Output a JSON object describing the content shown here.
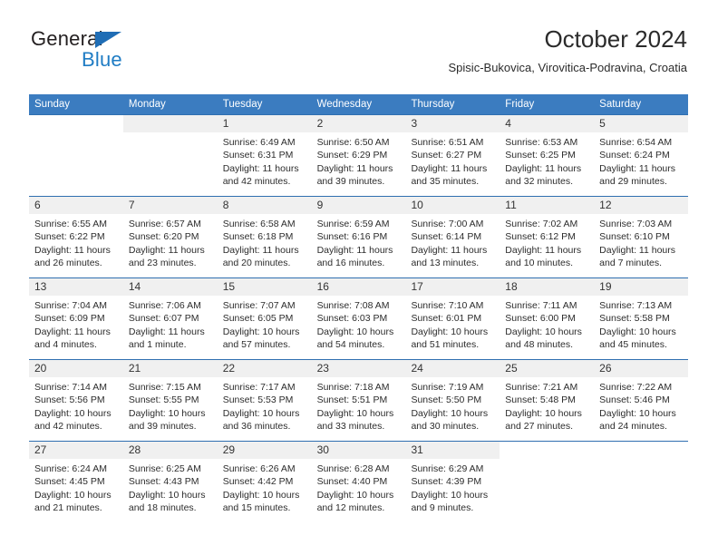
{
  "brand": {
    "name_top": "General",
    "name_bottom": "Blue",
    "triangle_color": "#1f6db5",
    "blue_color": "#1f7cc4"
  },
  "header": {
    "title": "October 2024",
    "subtitle": "Spisic-Bukovica, Virovitica-Podravina, Croatia"
  },
  "theme": {
    "header_bg": "#3b7cc0",
    "row_border": "#2f6fb0",
    "daynum_bg": "#f0f0f0",
    "text": "#2c2c2c"
  },
  "calendar": {
    "weekday_headers": [
      "Sunday",
      "Monday",
      "Tuesday",
      "Wednesday",
      "Thursday",
      "Friday",
      "Saturday"
    ],
    "weeks": [
      [
        {
          "day": "",
          "blank": true,
          "sunrise": "",
          "sunset": "",
          "daylight1": "",
          "daylight2": ""
        },
        {
          "day": "",
          "blank": false,
          "sunrise": "",
          "sunset": "",
          "daylight1": "",
          "daylight2": ""
        },
        {
          "day": "1",
          "sunrise": "Sunrise: 6:49 AM",
          "sunset": "Sunset: 6:31 PM",
          "daylight1": "Daylight: 11 hours",
          "daylight2": "and 42 minutes."
        },
        {
          "day": "2",
          "sunrise": "Sunrise: 6:50 AM",
          "sunset": "Sunset: 6:29 PM",
          "daylight1": "Daylight: 11 hours",
          "daylight2": "and 39 minutes."
        },
        {
          "day": "3",
          "sunrise": "Sunrise: 6:51 AM",
          "sunset": "Sunset: 6:27 PM",
          "daylight1": "Daylight: 11 hours",
          "daylight2": "and 35 minutes."
        },
        {
          "day": "4",
          "sunrise": "Sunrise: 6:53 AM",
          "sunset": "Sunset: 6:25 PM",
          "daylight1": "Daylight: 11 hours",
          "daylight2": "and 32 minutes."
        },
        {
          "day": "5",
          "sunrise": "Sunrise: 6:54 AM",
          "sunset": "Sunset: 6:24 PM",
          "daylight1": "Daylight: 11 hours",
          "daylight2": "and 29 minutes."
        }
      ],
      [
        {
          "day": "6",
          "sunrise": "Sunrise: 6:55 AM",
          "sunset": "Sunset: 6:22 PM",
          "daylight1": "Daylight: 11 hours",
          "daylight2": "and 26 minutes."
        },
        {
          "day": "7",
          "sunrise": "Sunrise: 6:57 AM",
          "sunset": "Sunset: 6:20 PM",
          "daylight1": "Daylight: 11 hours",
          "daylight2": "and 23 minutes."
        },
        {
          "day": "8",
          "sunrise": "Sunrise: 6:58 AM",
          "sunset": "Sunset: 6:18 PM",
          "daylight1": "Daylight: 11 hours",
          "daylight2": "and 20 minutes."
        },
        {
          "day": "9",
          "sunrise": "Sunrise: 6:59 AM",
          "sunset": "Sunset: 6:16 PM",
          "daylight1": "Daylight: 11 hours",
          "daylight2": "and 16 minutes."
        },
        {
          "day": "10",
          "sunrise": "Sunrise: 7:00 AM",
          "sunset": "Sunset: 6:14 PM",
          "daylight1": "Daylight: 11 hours",
          "daylight2": "and 13 minutes."
        },
        {
          "day": "11",
          "sunrise": "Sunrise: 7:02 AM",
          "sunset": "Sunset: 6:12 PM",
          "daylight1": "Daylight: 11 hours",
          "daylight2": "and 10 minutes."
        },
        {
          "day": "12",
          "sunrise": "Sunrise: 7:03 AM",
          "sunset": "Sunset: 6:10 PM",
          "daylight1": "Daylight: 11 hours",
          "daylight2": "and 7 minutes."
        }
      ],
      [
        {
          "day": "13",
          "sunrise": "Sunrise: 7:04 AM",
          "sunset": "Sunset: 6:09 PM",
          "daylight1": "Daylight: 11 hours",
          "daylight2": "and 4 minutes."
        },
        {
          "day": "14",
          "sunrise": "Sunrise: 7:06 AM",
          "sunset": "Sunset: 6:07 PM",
          "daylight1": "Daylight: 11 hours",
          "daylight2": "and 1 minute."
        },
        {
          "day": "15",
          "sunrise": "Sunrise: 7:07 AM",
          "sunset": "Sunset: 6:05 PM",
          "daylight1": "Daylight: 10 hours",
          "daylight2": "and 57 minutes."
        },
        {
          "day": "16",
          "sunrise": "Sunrise: 7:08 AM",
          "sunset": "Sunset: 6:03 PM",
          "daylight1": "Daylight: 10 hours",
          "daylight2": "and 54 minutes."
        },
        {
          "day": "17",
          "sunrise": "Sunrise: 7:10 AM",
          "sunset": "Sunset: 6:01 PM",
          "daylight1": "Daylight: 10 hours",
          "daylight2": "and 51 minutes."
        },
        {
          "day": "18",
          "sunrise": "Sunrise: 7:11 AM",
          "sunset": "Sunset: 6:00 PM",
          "daylight1": "Daylight: 10 hours",
          "daylight2": "and 48 minutes."
        },
        {
          "day": "19",
          "sunrise": "Sunrise: 7:13 AM",
          "sunset": "Sunset: 5:58 PM",
          "daylight1": "Daylight: 10 hours",
          "daylight2": "and 45 minutes."
        }
      ],
      [
        {
          "day": "20",
          "sunrise": "Sunrise: 7:14 AM",
          "sunset": "Sunset: 5:56 PM",
          "daylight1": "Daylight: 10 hours",
          "daylight2": "and 42 minutes."
        },
        {
          "day": "21",
          "sunrise": "Sunrise: 7:15 AM",
          "sunset": "Sunset: 5:55 PM",
          "daylight1": "Daylight: 10 hours",
          "daylight2": "and 39 minutes."
        },
        {
          "day": "22",
          "sunrise": "Sunrise: 7:17 AM",
          "sunset": "Sunset: 5:53 PM",
          "daylight1": "Daylight: 10 hours",
          "daylight2": "and 36 minutes."
        },
        {
          "day": "23",
          "sunrise": "Sunrise: 7:18 AM",
          "sunset": "Sunset: 5:51 PM",
          "daylight1": "Daylight: 10 hours",
          "daylight2": "and 33 minutes."
        },
        {
          "day": "24",
          "sunrise": "Sunrise: 7:19 AM",
          "sunset": "Sunset: 5:50 PM",
          "daylight1": "Daylight: 10 hours",
          "daylight2": "and 30 minutes."
        },
        {
          "day": "25",
          "sunrise": "Sunrise: 7:21 AM",
          "sunset": "Sunset: 5:48 PM",
          "daylight1": "Daylight: 10 hours",
          "daylight2": "and 27 minutes."
        },
        {
          "day": "26",
          "sunrise": "Sunrise: 7:22 AM",
          "sunset": "Sunset: 5:46 PM",
          "daylight1": "Daylight: 10 hours",
          "daylight2": "and 24 minutes."
        }
      ],
      [
        {
          "day": "27",
          "sunrise": "Sunrise: 6:24 AM",
          "sunset": "Sunset: 4:45 PM",
          "daylight1": "Daylight: 10 hours",
          "daylight2": "and 21 minutes."
        },
        {
          "day": "28",
          "sunrise": "Sunrise: 6:25 AM",
          "sunset": "Sunset: 4:43 PM",
          "daylight1": "Daylight: 10 hours",
          "daylight2": "and 18 minutes."
        },
        {
          "day": "29",
          "sunrise": "Sunrise: 6:26 AM",
          "sunset": "Sunset: 4:42 PM",
          "daylight1": "Daylight: 10 hours",
          "daylight2": "and 15 minutes."
        },
        {
          "day": "30",
          "sunrise": "Sunrise: 6:28 AM",
          "sunset": "Sunset: 4:40 PM",
          "daylight1": "Daylight: 10 hours",
          "daylight2": "and 12 minutes."
        },
        {
          "day": "31",
          "sunrise": "Sunrise: 6:29 AM",
          "sunset": "Sunset: 4:39 PM",
          "daylight1": "Daylight: 10 hours",
          "daylight2": "and 9 minutes."
        },
        {
          "day": "",
          "blank": true,
          "sunrise": "",
          "sunset": "",
          "daylight1": "",
          "daylight2": ""
        },
        {
          "day": "",
          "blank": true,
          "sunrise": "",
          "sunset": "",
          "daylight1": "",
          "daylight2": ""
        }
      ]
    ]
  }
}
